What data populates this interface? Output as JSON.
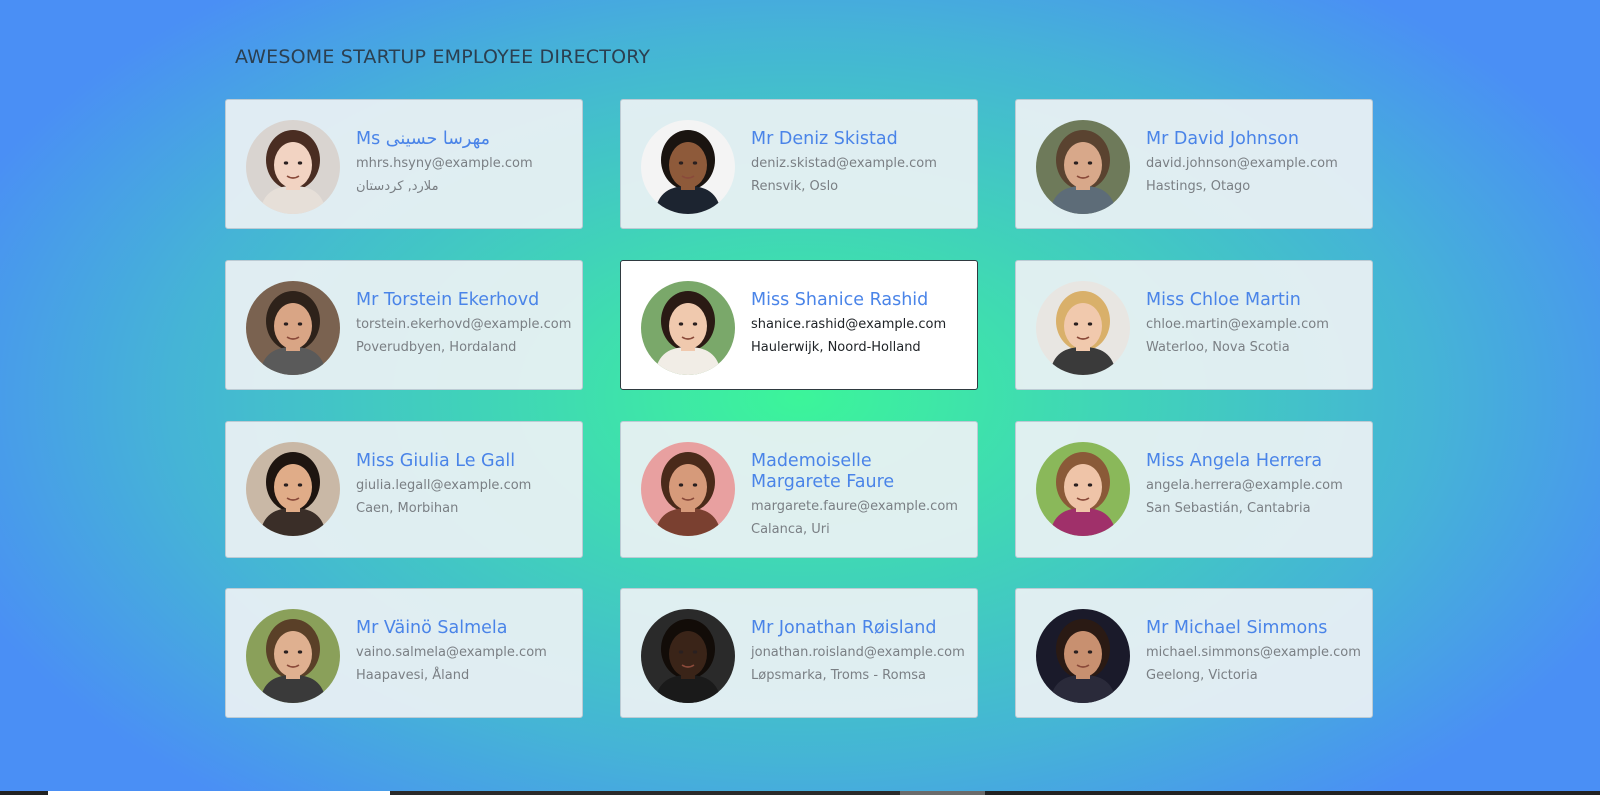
{
  "page": {
    "title": "AWESOME STARTUP EMPLOYEE DIRECTORY"
  },
  "colors": {
    "accent": "#4a84e8",
    "muted_text": "#7a7f84",
    "card_bg": "#ecf1f4",
    "selected_card_bg": "#ffffff"
  },
  "employees": [
    {
      "name": "Ms مهرسا حسینی",
      "email": "mhrs.hsyny@example.com",
      "location": "ملارد, کردستان",
      "selected": false,
      "avatar": {
        "skin": "#f2d3c2",
        "hair": "#4a2d22",
        "shirt": "#e6dfd8",
        "bg": "#d9d4d0"
      }
    },
    {
      "name": "Mr Deniz Skistad",
      "email": "deniz.skistad@example.com",
      "location": "Rensvik, Oslo",
      "selected": false,
      "avatar": {
        "skin": "#8e5a3a",
        "hair": "#1a1410",
        "shirt": "#1c2430",
        "bg": "#f4f4f4"
      }
    },
    {
      "name": "Mr David Johnson",
      "email": "david.johnson@example.com",
      "location": "Hastings, Otago",
      "selected": false,
      "avatar": {
        "skin": "#d8a88a",
        "hair": "#5a4330",
        "shirt": "#5d6c78",
        "bg": "#6e7a5a"
      }
    },
    {
      "name": "Mr Torstein Ekerhovd",
      "email": "torstein.ekerhovd@example.com",
      "location": "Poverudbyen, Hordaland",
      "selected": false,
      "avatar": {
        "skin": "#d9a585",
        "hair": "#2e221a",
        "shirt": "#5a5a5a",
        "bg": "#7a6250"
      }
    },
    {
      "name": "Miss Shanice Rashid",
      "email": "shanice.rashid@example.com",
      "location": "Haulerwijk, Noord-Holland",
      "selected": true,
      "avatar": {
        "skin": "#f0c9ae",
        "hair": "#2a1a14",
        "shirt": "#f1ede6",
        "bg": "#7aa86a"
      }
    },
    {
      "name": "Miss Chloe Martin",
      "email": "chloe.martin@example.com",
      "location": "Waterloo, Nova Scotia",
      "selected": false,
      "avatar": {
        "skin": "#f1c9ad",
        "hair": "#d9b06a",
        "shirt": "#3a3a3a",
        "bg": "#e8e6e2"
      }
    },
    {
      "name": "Miss Giulia Le Gall",
      "email": "giulia.legall@example.com",
      "location": "Caen, Morbihan",
      "selected": false,
      "avatar": {
        "skin": "#e0ac88",
        "hair": "#1e1510",
        "shirt": "#3a2e28",
        "bg": "#c9b8a6"
      }
    },
    {
      "name": "Mademoiselle Margarete Faure",
      "email": "margarete.faure@example.com",
      "location": "Calanca, Uri",
      "selected": false,
      "avatar": {
        "skin": "#d69a7a",
        "hair": "#4a2a1a",
        "shirt": "#7a4030",
        "bg": "#e8a0a0"
      }
    },
    {
      "name": "Miss Angela Herrera",
      "email": "angela.herrera@example.com",
      "location": "San Sebastián, Cantabria",
      "selected": false,
      "avatar": {
        "skin": "#efc4a8",
        "hair": "#8a5a38",
        "shirt": "#a0306a",
        "bg": "#8ab85a"
      }
    },
    {
      "name": "Mr Väinö Salmela",
      "email": "vaino.salmela@example.com",
      "location": "Haapavesi, Åland",
      "selected": false,
      "avatar": {
        "skin": "#dfb090",
        "hair": "#5a4028",
        "shirt": "#3a3a3a",
        "bg": "#8aa05a"
      }
    },
    {
      "name": "Mr Jonathan Røisland",
      "email": "jonathan.roisland@example.com",
      "location": "Løpsmarka, Troms - Romsa",
      "selected": false,
      "avatar": {
        "skin": "#3a2418",
        "hair": "#120c08",
        "shirt": "#1a1a1a",
        "bg": "#2a2a2a"
      }
    },
    {
      "name": "Mr Michael Simmons",
      "email": "michael.simmons@example.com",
      "location": "Geelong, Victoria",
      "selected": false,
      "avatar": {
        "skin": "#c89070",
        "hair": "#2a1a14",
        "shirt": "#2a2a3a",
        "bg": "#1a1a2a"
      }
    }
  ]
}
